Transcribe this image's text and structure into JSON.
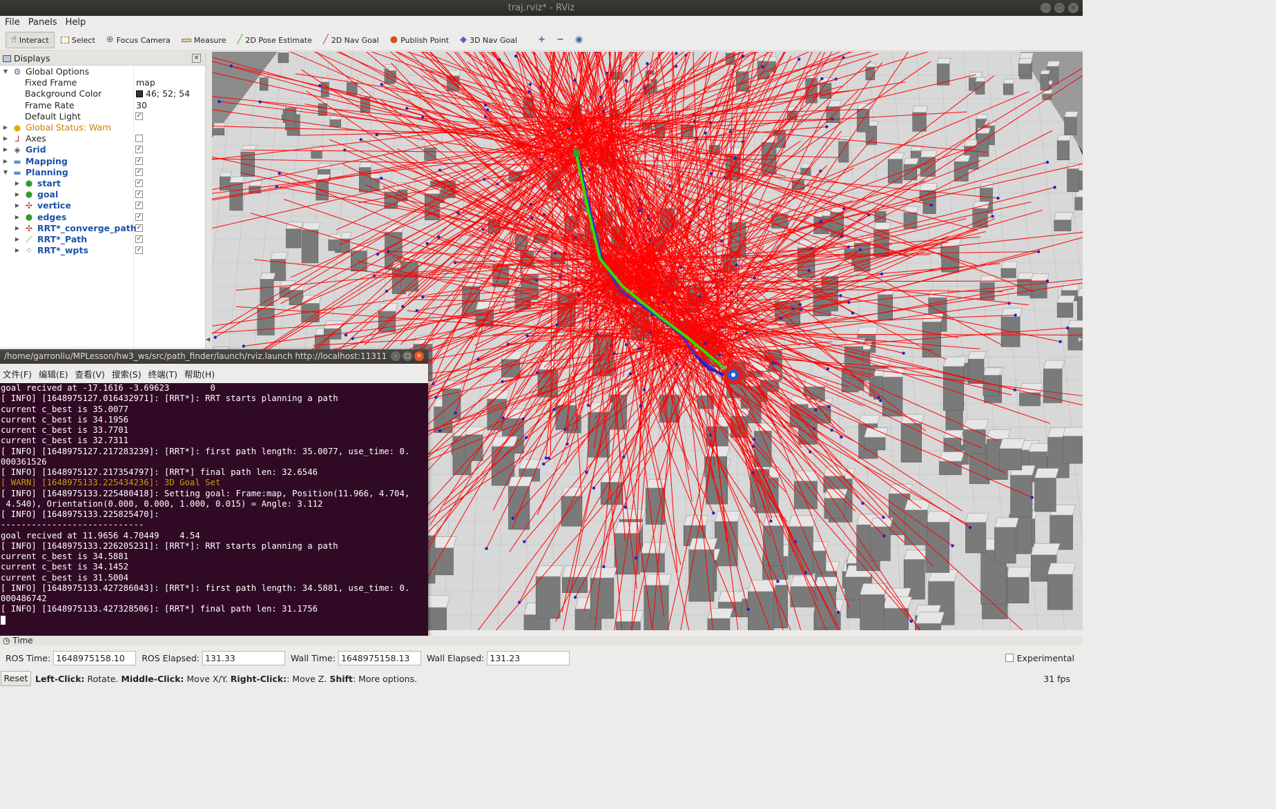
{
  "window": {
    "title": "traj.rviz* - RViz"
  },
  "menu": [
    "File",
    "Panels",
    "Help"
  ],
  "toolbar": {
    "tools": [
      {
        "label": "Interact",
        "icon": "hand-icon",
        "active": true
      },
      {
        "label": "Select",
        "icon": "select-icon"
      },
      {
        "label": "Focus Camera",
        "icon": "focus-camera-icon"
      },
      {
        "label": "Measure",
        "icon": "ruler-icon"
      },
      {
        "label": "2D Pose Estimate",
        "icon": "pose-arrow-icon"
      },
      {
        "label": "2D Nav Goal",
        "icon": "nav-arrow-icon"
      },
      {
        "label": "Publish Point",
        "icon": "pin-icon"
      },
      {
        "label": "3D Nav Goal",
        "icon": "cube-goal-icon"
      }
    ]
  },
  "displays": {
    "title": "Displays",
    "items": [
      {
        "label": "Global Options",
        "value": "",
        "icon": "gear-icon",
        "indent": 0,
        "expanded": true
      },
      {
        "label": "Fixed Frame",
        "value": "map",
        "indent": 1
      },
      {
        "label": "Background Color",
        "value": "46; 52; 54",
        "swatch": "#2e3436",
        "indent": 1
      },
      {
        "label": "Frame Rate",
        "value": "30",
        "indent": 1
      },
      {
        "label": "Default Light",
        "checked": true,
        "indent": 1
      },
      {
        "label": "Global Status: Warn",
        "icon": "warning-icon",
        "indent": 0,
        "style": "warn"
      },
      {
        "label": "Axes",
        "icon": "axes-icon",
        "checked": false,
        "indent": 0
      },
      {
        "label": "Grid",
        "icon": "grid-icon",
        "checked": true,
        "indent": 0,
        "style": "blue"
      },
      {
        "label": "Mapping",
        "icon": "folder-icon",
        "checked": true,
        "indent": 0,
        "style": "blue"
      },
      {
        "label": "Planning",
        "icon": "folder-icon",
        "checked": true,
        "indent": 0,
        "style": "blue",
        "expanded": true
      },
      {
        "label": "start",
        "icon": "marker-cube-icon",
        "checked": true,
        "indent": 1,
        "style": "blue"
      },
      {
        "label": "goal",
        "icon": "marker-cube-icon",
        "checked": true,
        "indent": 1,
        "style": "blue"
      },
      {
        "label": "vertice",
        "icon": "marker-array-icon",
        "checked": true,
        "indent": 1,
        "style": "blue"
      },
      {
        "label": "edges",
        "icon": "marker-cube-icon",
        "checked": true,
        "indent": 1,
        "style": "blue"
      },
      {
        "label": "RRT*_converge_paths",
        "icon": "marker-array-icon",
        "checked": true,
        "indent": 1,
        "style": "blue"
      },
      {
        "label": "RRT*_Path",
        "icon": "path-icon",
        "checked": true,
        "indent": 1,
        "style": "blue"
      },
      {
        "label": "RRT*_wpts",
        "icon": "pointcloud-icon",
        "checked": true,
        "indent": 1,
        "style": "blue"
      }
    ]
  },
  "terminal": {
    "title": "/home/garronliu/MPLesson/hw3_ws/src/path_finder/launch/rviz.launch http://localhost:11311",
    "menu": [
      "文件(F)",
      "编辑(E)",
      "查看(V)",
      "搜索(S)",
      "终端(T)",
      "帮助(H)"
    ],
    "lines": [
      "goal recived at -17.1616 -3.69623        0",
      "[ INFO] [1648975127.016432971]: [RRT*]: RRT starts planning a path",
      "current c_best is 35.0077",
      "current c_best is 34.1956",
      "current c_best is 33.7701",
      "current c_best is 32.7311",
      "[ INFO] [1648975127.217283239]: [RRT*]: first path length: 35.0077, use_time: 0.",
      "000361526",
      "[ INFO] [1648975127.217354797]: [RRT*] final path len: 32.6546",
      "[ WARN] [1648975133.225434236]: 3D Goal Set",
      "[ INFO] [1648975133.225480418]: Setting goal: Frame:map, Position(11.966, 4.704,",
      " 4.540), Orientation(0.000, 0.000, 1.000, 0.015) = Angle: 3.112",
      "",
      "[ INFO] [1648975133.225825470]:",
      "----------------------------",
      "goal recived at 11.9656 4.70449    4.54",
      "[ INFO] [1648975133.226205231]: [RRT*]: RRT starts planning a path",
      "current c_best is 34.5881",
      "current c_best is 34.1452",
      "current c_best is 31.5004",
      "[ INFO] [1648975133.427286043]: [RRT*]: first path length: 34.5881, use_time: 0.",
      "000486742",
      "[ INFO] [1648975133.427328506]: [RRT*] final path len: 31.1756"
    ]
  },
  "time_panel": {
    "title": "Time",
    "ros_time_label": "ROS Time:",
    "ros_time": "1648975158.10",
    "ros_elapsed_label": "ROS Elapsed:",
    "ros_elapsed": "131.33",
    "wall_time_label": "Wall Time:",
    "wall_time": "1648975158.13",
    "wall_elapsed_label": "Wall Elapsed:",
    "wall_elapsed": "131.23",
    "experimental_label": "Experimental"
  },
  "status": {
    "reset_label": "Reset",
    "hint_parts": [
      {
        "b": "Left-Click:",
        "t": " Rotate. "
      },
      {
        "b": "Middle-Click:",
        "t": " Move X/Y. "
      },
      {
        "b": "Right-Click:",
        "t": ": Move Z. "
      },
      {
        "b": "Shift",
        "t": ": More options."
      }
    ],
    "fps": "31 fps"
  },
  "colors": {
    "viewport_bg": "#2e3436",
    "ray": "#ff0000",
    "vertex": "#1f22c8",
    "path": "#33dd00",
    "terminal_bg": "#300a24",
    "warn": "#c4a000"
  }
}
